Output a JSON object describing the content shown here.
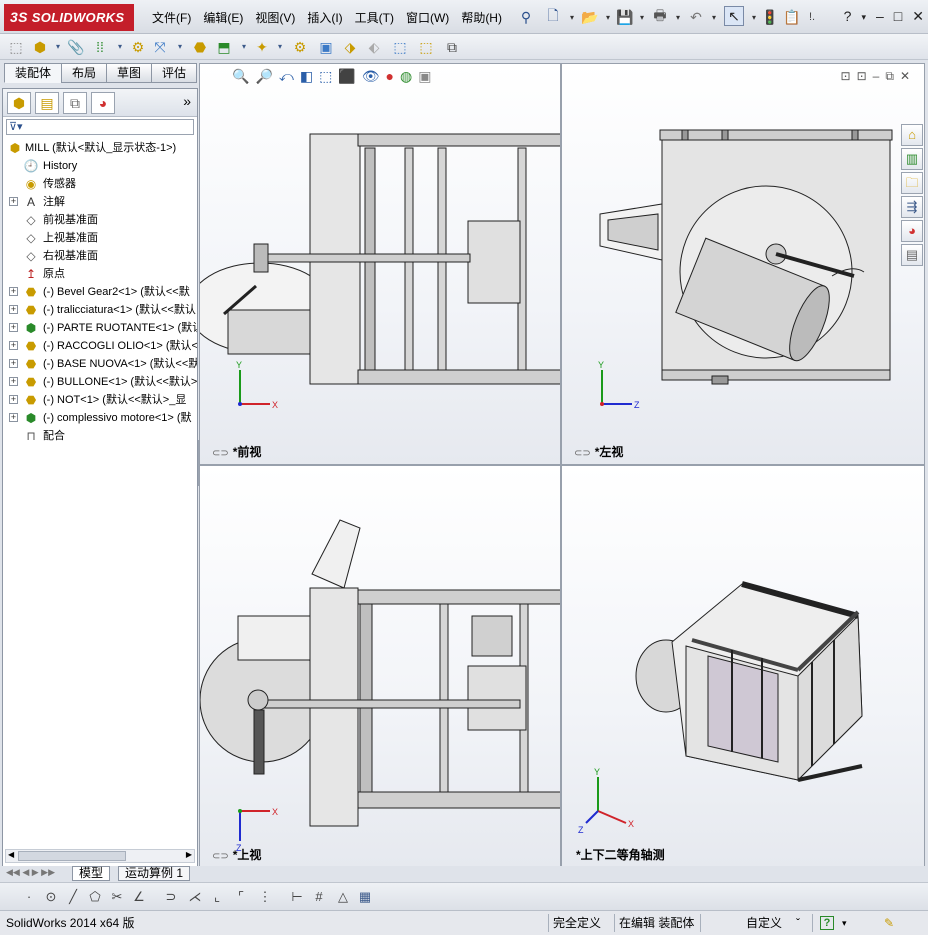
{
  "app": {
    "logo": "SOLIDWORKS",
    "logo_mark": "3S"
  },
  "menu": [
    "文件(F)",
    "编辑(E)",
    "视图(V)",
    "插入(I)",
    "工具(T)",
    "窗口(W)",
    "帮助(H)"
  ],
  "window_controls": {
    "help": "?",
    "minimize": "–",
    "restore": "□",
    "close": "✕"
  },
  "command_tabs": [
    "装配体",
    "布局",
    "草图",
    "评估"
  ],
  "left_panel": {
    "more": "»",
    "filter_icon": "filter-icon",
    "tree": [
      {
        "label": "MILL  (默认<默认_显示状态-1>)",
        "icon": "assembly-icon",
        "expand": false,
        "root": true
      },
      {
        "label": "History",
        "icon": "history-icon",
        "expand": false
      },
      {
        "label": "传感器",
        "icon": "sensor-icon",
        "expand": false
      },
      {
        "label": "注解",
        "icon": "annotation-icon",
        "expand": true
      },
      {
        "label": "前视基准面",
        "icon": "plane-icon",
        "expand": false
      },
      {
        "label": "上视基准面",
        "icon": "plane-icon",
        "expand": false
      },
      {
        "label": "右视基准面",
        "icon": "plane-icon",
        "expand": false
      },
      {
        "label": "原点",
        "icon": "origin-icon",
        "expand": false
      },
      {
        "label": "(-) Bevel Gear2<1> (默认<<默",
        "icon": "part-icon",
        "expand": true
      },
      {
        "label": "(-) tralicciatura<1> (默认<<默认",
        "icon": "part-icon",
        "expand": true
      },
      {
        "label": "(-) PARTE RUOTANTE<1> (默认",
        "icon": "subassembly-icon",
        "expand": true
      },
      {
        "label": "(-) RACCOGLI OLIO<1> (默认<",
        "icon": "part-icon",
        "expand": true
      },
      {
        "label": "(-) BASE NUOVA<1> (默认<<默",
        "icon": "part-icon",
        "expand": true
      },
      {
        "label": "(-) BULLONE<1> (默认<<默认>",
        "icon": "part-icon",
        "expand": true
      },
      {
        "label": "(-) NOT<1> (默认<<默认>_显",
        "icon": "part-icon",
        "expand": true
      },
      {
        "label": "(-) complessivo motore<1> (默",
        "icon": "subassembly-icon",
        "expand": true
      },
      {
        "label": "配合",
        "icon": "mates-icon",
        "expand": false
      }
    ]
  },
  "viewports": {
    "front": "*前视",
    "left": "*左视",
    "top": "*上视",
    "iso": "*上下二等角轴测"
  },
  "bottom_tabs": [
    "模型",
    "运动算例 1"
  ],
  "status": {
    "app_version": "SolidWorks 2014 x64 版",
    "definition": "完全定义",
    "mode": "在编辑 装配体",
    "units": "自定义",
    "units_arrow": "ˇ"
  },
  "colors": {
    "brand": "#c41e2a",
    "axis_x": "#d0232a",
    "axis_y": "#1a9a1a",
    "axis_z": "#1f2bd0"
  }
}
